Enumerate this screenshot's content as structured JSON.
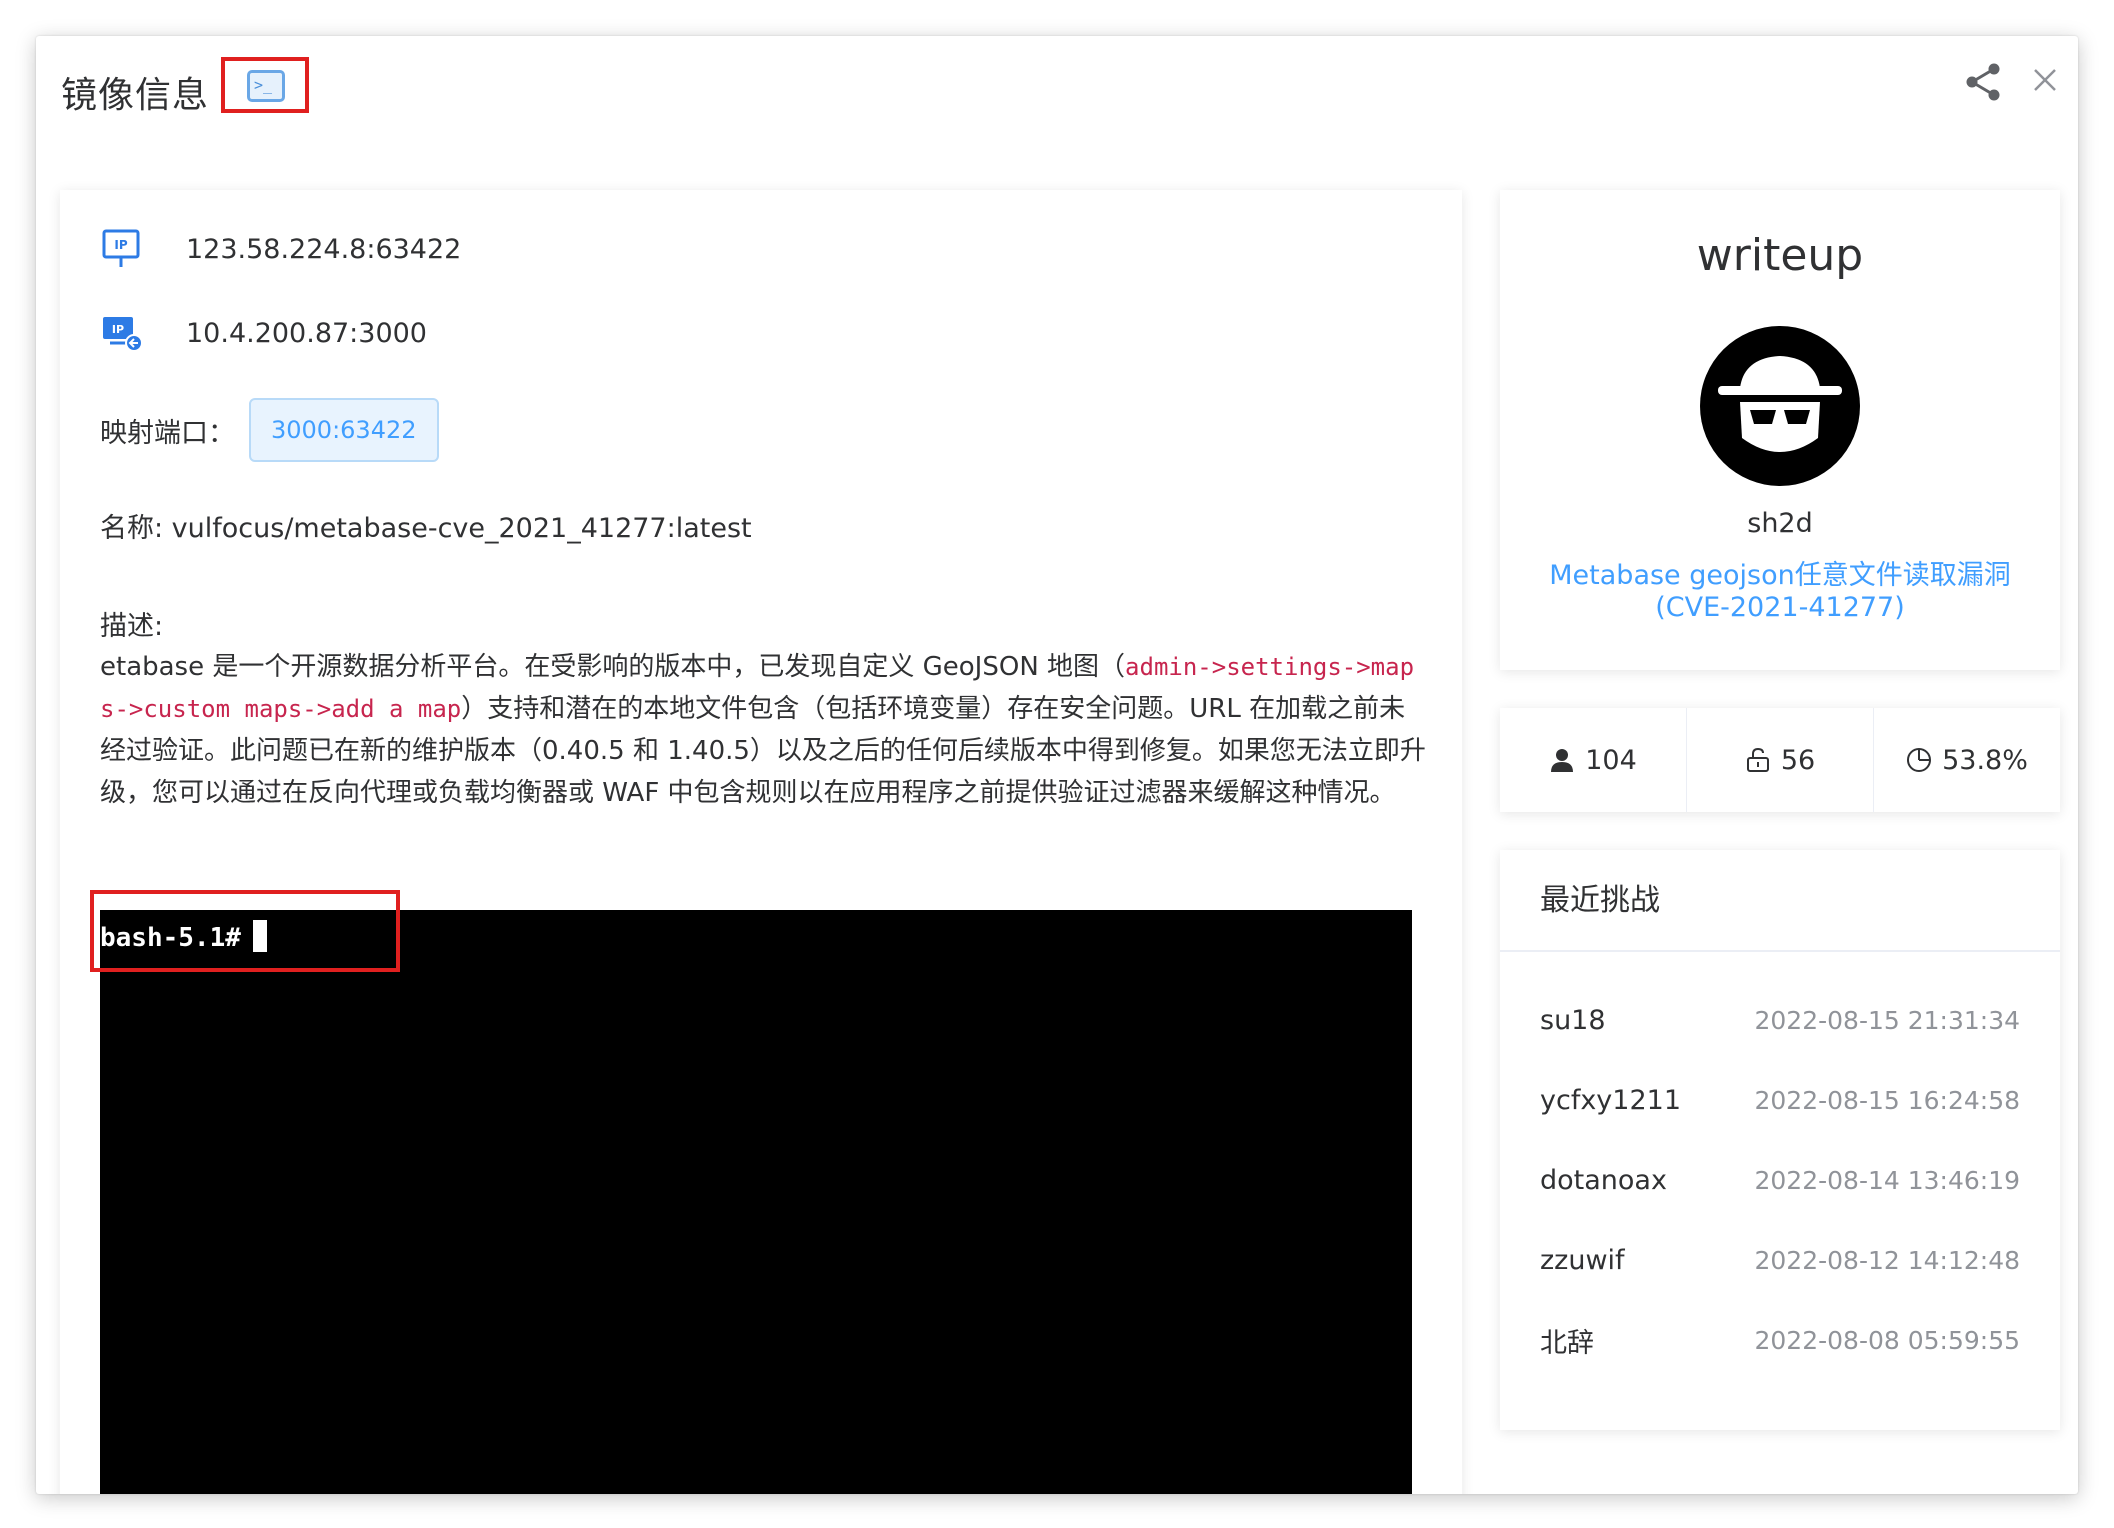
{
  "dialog": {
    "title": "镜像信息"
  },
  "info": {
    "public_address": "123.58.224.8:63422",
    "internal_address": "10.4.200.87:3000",
    "port_label": "映射端口：",
    "port_value": "3000:63422",
    "name_text": "名称: vulfocus/metabase-cve_2021_41277:latest",
    "desc_label": "描述:",
    "desc_part1": "etabase 是一个开源数据分析平台。在受影响的版本中，已发现自定义 GeoJSON 地图（",
    "desc_code1": "admin->settings->map",
    "desc_code2": "s->custom maps->add a map",
    "desc_part2": "）支持和潜在的本地文件包含（包括环境变量）存在安全问题。URL 在加载之前未经过验证。此问题已在新的维护版本（0.40.5 和 1.40.5）以及之后的任何后续版本中得到修复。如果您无法立即升级，您可以通过在反向代理或负载均衡器或 WAF 中包含规则以在应用程序之前提供验证过滤器来缓解这种情况。"
  },
  "terminal": {
    "prompt": "bash-5.1#"
  },
  "writeup": {
    "title": "writeup",
    "author": "sh2d",
    "link_text": "Metabase geojson任意文件读取漏洞(CVE-2021-41277)"
  },
  "stats": {
    "users": "104",
    "solved": "56",
    "rate": "53.8%"
  },
  "recent": {
    "title": "最近挑战",
    "rows": [
      {
        "user": "su18",
        "time": "2022-08-15 21:31:34"
      },
      {
        "user": "ycfxy1211",
        "time": "2022-08-15 16:24:58"
      },
      {
        "user": "dotanoax",
        "time": "2022-08-14 13:46:19"
      },
      {
        "user": "zzuwif",
        "time": "2022-08-12 14:12:48"
      },
      {
        "user": "北辞",
        "time": "2022-08-08 05:59:55"
      }
    ]
  },
  "colors": {
    "accent": "#409eff",
    "highlight_box": "#e0201f",
    "code": "#c7254e",
    "terminal_bg": "#000000"
  },
  "icons": [
    "terminal-icon",
    "share-icon",
    "close-icon",
    "ip-icon",
    "ip-remote-icon",
    "user-icon",
    "unlock-icon",
    "pie-icon"
  ]
}
